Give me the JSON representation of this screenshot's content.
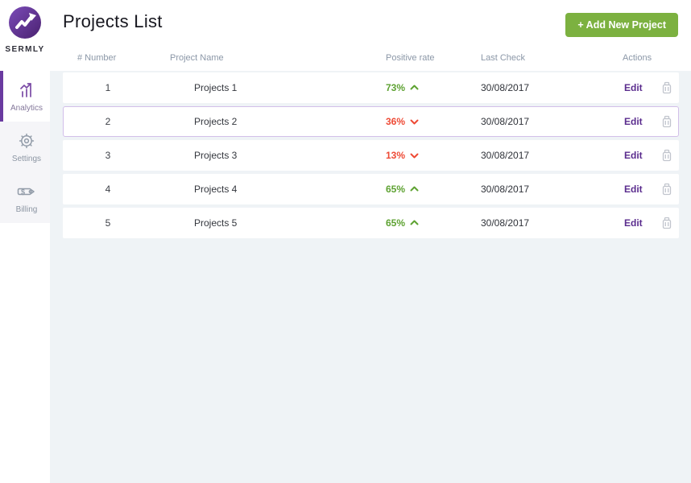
{
  "brand": {
    "name": "SERMLY",
    "logo_icon": "trend-arrow-logo-icon"
  },
  "sidebar": {
    "items": [
      {
        "label": "Analytics",
        "icon": "bar-chart-icon",
        "active": true
      },
      {
        "label": "Settings",
        "icon": "gear-icon",
        "active": false
      },
      {
        "label": "Billing",
        "icon": "price-tag-icon",
        "active": false
      }
    ]
  },
  "header": {
    "title": "Projects List",
    "add_button_label": "+ Add New Project"
  },
  "table": {
    "columns": [
      "# Number",
      "Project Name",
      "Positive rate",
      "Last Check",
      "Actions"
    ],
    "edit_label": "Edit",
    "delete_icon": "trash-icon",
    "trend_icons": {
      "up": "chevron-up-icon",
      "down": "chevron-down-icon"
    },
    "rows": [
      {
        "number": "1",
        "name": "Projects 1",
        "rate": "73%",
        "trend": "up",
        "last_check": "30/08/2017",
        "selected": false
      },
      {
        "number": "2",
        "name": "Projects 2",
        "rate": "36%",
        "trend": "down",
        "last_check": "30/08/2017",
        "selected": true
      },
      {
        "number": "3",
        "name": "Projects 3",
        "rate": "13%",
        "trend": "down",
        "last_check": "30/08/2017",
        "selected": false
      },
      {
        "number": "4",
        "name": "Projects 4",
        "rate": "65%",
        "trend": "up",
        "last_check": "30/08/2017",
        "selected": false
      },
      {
        "number": "5",
        "name": "Projects 5",
        "rate": "65%",
        "trend": "up",
        "last_check": "30/08/2017",
        "selected": false
      }
    ]
  },
  "colors": {
    "accent_purple": "#5b2d8e",
    "positive_green": "#5ea232",
    "negative_red": "#ee4a35",
    "button_green": "#7cb140",
    "page_background": "#eff3f6",
    "sidebar_menu_background": "#f5f5f8"
  }
}
